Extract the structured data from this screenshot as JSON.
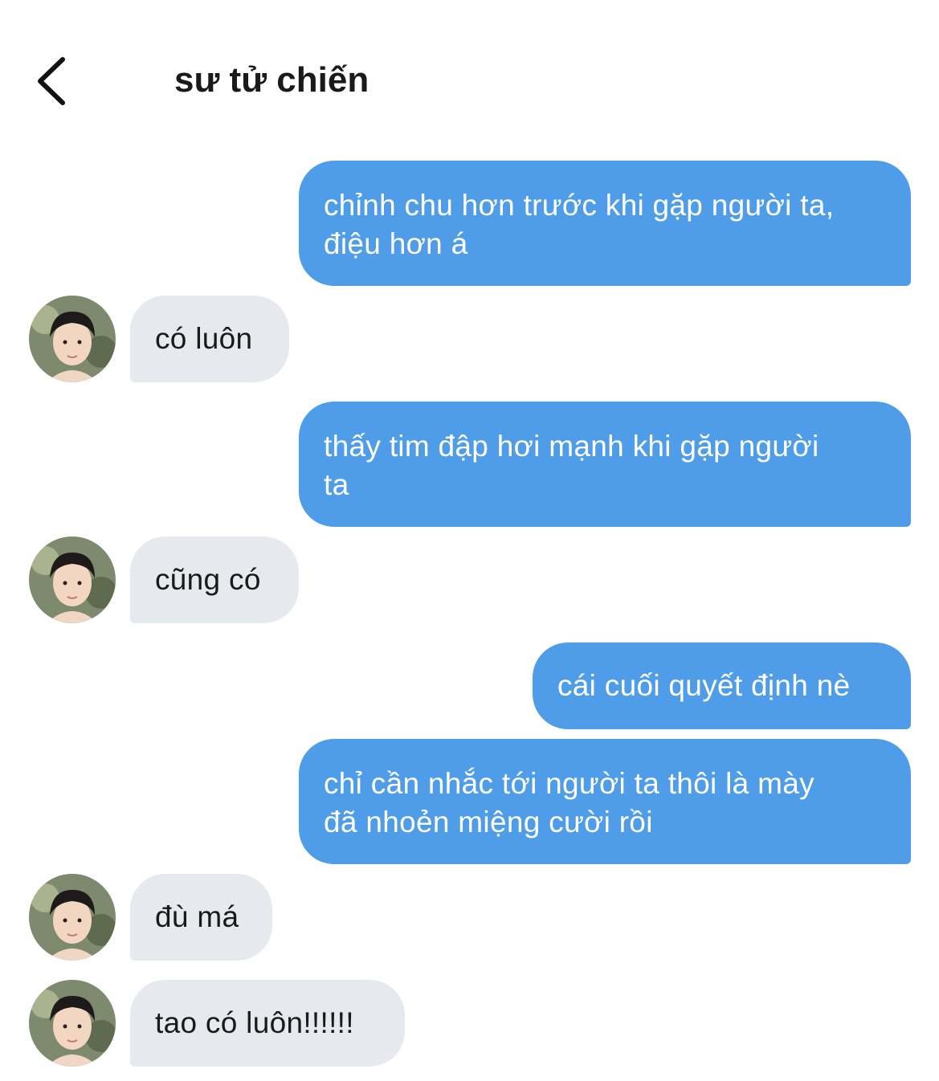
{
  "header": {
    "title": "sư tử chiến",
    "back_icon": "chevron-left-icon"
  },
  "contact": {
    "avatar_icon": "contact-avatar"
  },
  "messages": [
    {
      "side": "outgoing",
      "lines": [
        "chỉnh chu hơn trước khi gặp người ta,",
        "điệu hơn á"
      ]
    },
    {
      "side": "incoming",
      "lines": [
        "có luôn"
      ]
    },
    {
      "side": "outgoing",
      "lines": [
        "thấy tim đập hơi mạnh khi gặp người",
        "ta"
      ]
    },
    {
      "side": "incoming",
      "lines": [
        "cũng có"
      ]
    },
    {
      "side": "outgoing",
      "lines": [
        "cái cuối quyết định nè"
      ]
    },
    {
      "side": "outgoing",
      "lines": [
        "chỉ cần nhắc tới người ta thôi là mày",
        "đã nhoẻn miệng cười rồi"
      ]
    },
    {
      "side": "incoming",
      "lines": [
        "đù má"
      ]
    },
    {
      "side": "incoming",
      "lines": [
        "tao có luôn!!!!!!"
      ]
    }
  ],
  "colors": {
    "outgoing_bubble": "#4f9de8",
    "incoming_bubble": "#e6eaee",
    "outgoing_text": "#ffffff",
    "incoming_text": "#1a1a1a"
  }
}
